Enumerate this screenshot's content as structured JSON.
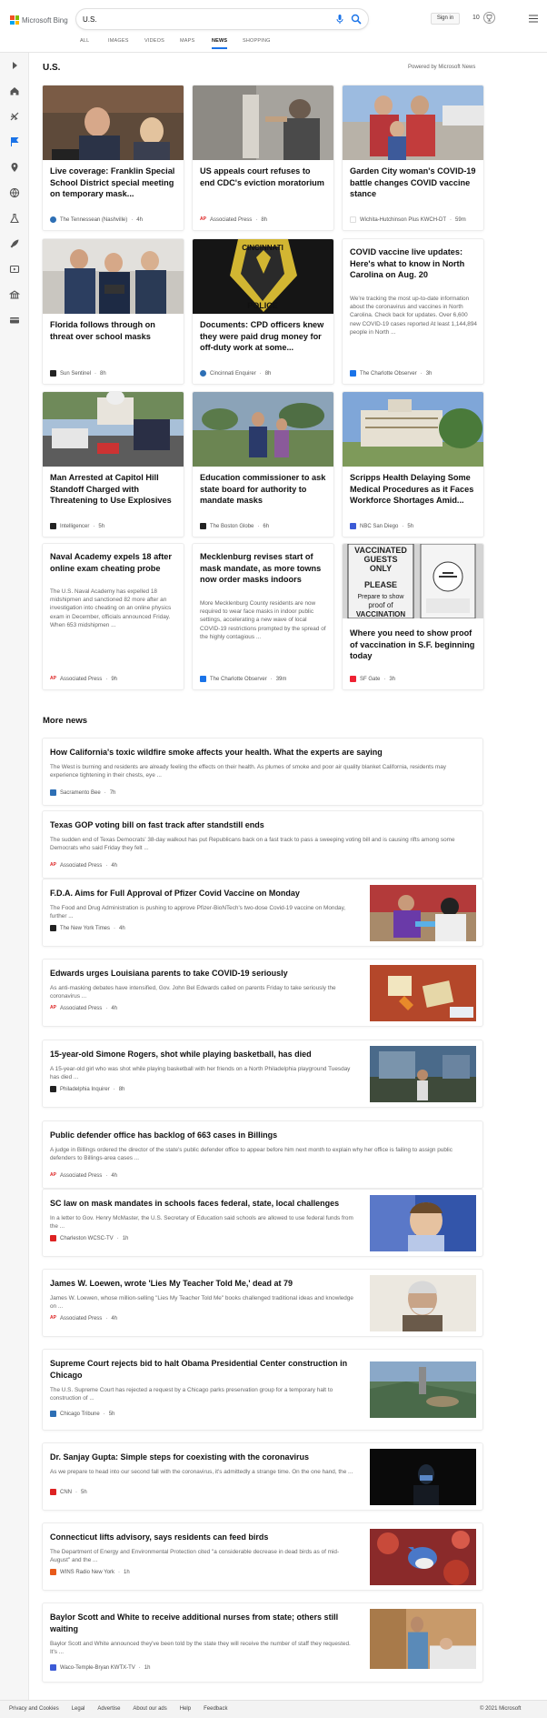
{
  "header": {
    "logo_text": "Microsoft Bing",
    "search_value": "U.S.",
    "signin_label": "Sign in",
    "points": "10"
  },
  "tabs": [
    {
      "label": "ALL"
    },
    {
      "label": "IMAGES"
    },
    {
      "label": "VIDEOS"
    },
    {
      "label": "MAPS"
    },
    {
      "label": "NEWS",
      "active": true
    },
    {
      "label": "SHOPPING"
    }
  ],
  "rail_icons": [
    "expand-icon",
    "home-icon",
    "sports-icon",
    "flag-icon",
    "location-icon",
    "world-icon",
    "science-icon",
    "rocket-icon",
    "entertainment-icon",
    "business-icon",
    "money-icon"
  ],
  "section": {
    "title": "U.S.",
    "powered": "Powered by Microsoft News"
  },
  "cards": [
    {
      "title": "Live coverage: Franklin Special School District special meeting on temporary mask...",
      "source": "The Tennessean (Nashville)",
      "time": "4h",
      "fav_color": "#2d6fb5",
      "img_colors": [
        "#6b4f3a",
        "#a88b6a"
      ]
    },
    {
      "title": "US appeals court refuses to end CDC's eviction moratorium",
      "source": "Associated Press",
      "time": "8h",
      "fav_color": "#d22",
      "img_colors": [
        "#9c9a94",
        "#5a5855"
      ]
    },
    {
      "title": "Garden City woman's COVID-19 battle changes COVID vaccine stance",
      "source": "Wichita-Hutchinson Plus KWCH-DT",
      "time": "59m",
      "fav_color": "#fff",
      "img_colors": [
        "#8ab0d8",
        "#b8554a"
      ]
    },
    {
      "title": "COVID vaccine live updates: Here's what to know in North Carolina on Aug. 20",
      "desc": "We're tracking the most up-to-date information about the coronavirus and vaccines in North Carolina. Check back for updates. Over 6,600 new COVID-19 cases reported At least 1,144,894 people in North ...",
      "source": "The Charlotte Observer",
      "time": "3h",
      "fav_color": "#1a73e8"
    },
    {
      "title": "Florida follows through on threat over school masks",
      "source": "Sun Sentinel",
      "time": "8h",
      "fav_color": "#222",
      "img_colors": [
        "#3b5c8a",
        "#c9c6c0"
      ]
    },
    {
      "title": "Documents: CPD officers knew they were paid drug money for off-duty work at some...",
      "source": "Cincinnati Enquirer",
      "time": "8h",
      "fav_color": "#2d6fb5",
      "img_colors": [
        "#1a1a1a",
        "#d2b632"
      ]
    },
    {
      "title": "Scripps Health Delaying Some Medical Procedures as it Faces Workforce Shortages Amid...",
      "source": "NBC San Diego",
      "time": "5h",
      "fav_color": "#3c5bd6",
      "img_colors": [
        "#7fa6d8",
        "#9a8b6a"
      ]
    },
    {
      "title": "Man Arrested at Capitol Hill Standoff Charged with Threatening to Use Explosives",
      "source": "Intelligencer",
      "time": "5h",
      "fav_color": "#222",
      "img_colors": [
        "#6f8a5a",
        "#3a3e52"
      ]
    },
    {
      "title": "Education commissioner to ask state board for authority to mandate masks",
      "source": "The Boston Globe",
      "time": "6h",
      "fav_color": "#222",
      "img_colors": [
        "#8ba3b8",
        "#6b8552"
      ]
    },
    {
      "title": "Naval Academy expels 18 after online exam cheating probe",
      "desc": "The U.S. Naval Academy has expelled 18 midshipmen and sanctioned 82 more after an investigation into cheating on an online physics exam in December, officials announced Friday. When 653 midshipmen ...",
      "source": "Associated Press",
      "time": "9h",
      "fav_color": "#d22"
    },
    {
      "title": "Mecklenburg revises start of mask mandate, as more towns now order masks indoors",
      "desc": "More Mecklenburg County residents are now required to wear face masks in indoor public settings, accelerating a new wave of local COVID-19 restrictions prompted by the spread of the highly contagious ...",
      "source": "The Charlotte Observer",
      "time": "39m",
      "fav_color": "#1a73e8"
    },
    {
      "title": "Where you need to show proof of vaccination in S.F. beginning today",
      "source": "SF Gate",
      "time": "3h",
      "fav_color": "#e23",
      "img_colors": [
        "#d9d9d9",
        "#333"
      ],
      "sign_text": [
        "VACCINATED",
        "GUESTS",
        "ONLY",
        "PLEASE",
        "Prepare to show",
        "proof of",
        "VACCINATION"
      ]
    }
  ],
  "more": {
    "title": "More news"
  },
  "news": [
    {
      "title": "How California's toxic wildfire smoke affects your health. What the experts are saying",
      "desc": "The West is burning and residents are already feeling the effects on their health. As plumes of smoke and poor air quality blanket California, residents may experience tightening in their chests, eye ...",
      "source": "Sacramento Bee",
      "time": "7h",
      "fav_color": "#2d6fb5"
    },
    {
      "title": "Texas GOP voting bill on fast track after standstill ends",
      "desc": "The sudden end of Texas Democrats' 38-day walkout has put Republicans back on a fast track to pass a sweeping voting bill and is causing rifts among some Democrats who said Friday they felt ...",
      "source": "Associated Press",
      "time": "4h",
      "fav_color": "#d22"
    },
    {
      "title": "F.D.A. Aims for Full Approval of Pfizer Covid Vaccine on Monday",
      "desc": "The Food and Drug Administration is pushing to approve Pfizer-BioNTech's two-dose Covid-19 vaccine on Monday, further ...",
      "source": "The New York Times",
      "time": "4h",
      "fav_color": "#222",
      "img_colors": [
        "#b33a3a",
        "#d8d2c8"
      ]
    },
    {
      "title": "Edwards urges Louisiana parents to take COVID-19 seriously",
      "desc": "As anti-masking debates have intensified, Gov. John Bel Edwards called on parents Friday to take seriously the coronavirus ...",
      "source": "Associated Press",
      "time": "4h",
      "fav_color": "#d22",
      "img_colors": [
        "#b4472a",
        "#e6d7a8"
      ]
    },
    {
      "title": "15-year-old Simone Rogers, shot while playing basketball, has died",
      "desc": "A 15-year-old girl who was shot while playing basketball with her friends on a North Philadelphia playground Tuesday has died ...",
      "source": "Philadelphia Inquirer",
      "time": "8h",
      "fav_color": "#222",
      "img_colors": [
        "#4a6a8a",
        "#3e4a3a"
      ]
    },
    {
      "title": "Public defender office has backlog of 663 cases in Billings",
      "desc": "A judge in Billings ordered the director of the state's public defender office to appear before him next month to explain why her office is failing to assign public defenders to Billings-area cases ...",
      "source": "Associated Press",
      "time": "4h",
      "fav_color": "#d22"
    },
    {
      "title": "SC law on mask mandates in schools faces federal, state, local challenges",
      "desc": "In a letter to Gov. Henry McMaster, the U.S. Secretary of Education said schools are allowed to use federal funds from the ...",
      "source": "Charleston WCSC-TV",
      "time": "1h",
      "fav_color": "#d22",
      "img_colors": [
        "#3355aa",
        "#b8c8e8"
      ]
    },
    {
      "title": "James W. Loewen, wrote 'Lies My Teacher Told Me,' dead at 79",
      "desc": "James W. Loewen, whose million-selling \"Lies My Teacher Told Me\" books challenged traditional ideas and knowledge on ...",
      "source": "Associated Press",
      "time": "4h",
      "fav_color": "#d22",
      "img_colors": [
        "#e8e2d8",
        "#8a7a66"
      ]
    },
    {
      "title": "Supreme Court rejects bid to halt Obama Presidential Center construction in Chicago",
      "desc": "The U.S. Supreme Court has rejected a request by a Chicago parks preservation group for a temporary halt to construction of ...",
      "source": "Chicago Tribune",
      "time": "5h",
      "fav_color": "#2d6fb5",
      "img_colors": [
        "#5a7a5a",
        "#8aa8c8"
      ]
    },
    {
      "title": "Dr. Sanjay Gupta: Simple steps for coexisting with the coronavirus",
      "desc": "As we prepare to head into our second fall with the coronavirus, it's admittedly a strange time. On the one hand, the ...",
      "source": "CNN",
      "time": "5h",
      "fav_color": "#d22",
      "img_colors": [
        "#0a0a0a",
        "#1e2a3a"
      ]
    },
    {
      "title": "Connecticut lifts advisory, says residents can feed birds",
      "desc": "The Department of Energy and Environmental Protection cited \"a considerable decrease in dead birds as of mid-August\" and the ...",
      "source": "WINS Radio New York",
      "time": "1h",
      "fav_color": "#e85a1a",
      "img_colors": [
        "#8a2a2a",
        "#c84a3a"
      ]
    },
    {
      "title": "Baylor Scott and White to receive additional nurses from state; others still waiting",
      "desc": "Baylor Scott and White announced they've been told by the state they will receive the number of staff they requested. It's ...",
      "source": "Waco-Temple-Bryan KWTX-TV",
      "time": "1h",
      "fav_color": "#3c5bd6",
      "img_colors": [
        "#c89a6a",
        "#5a8ab8"
      ]
    }
  ],
  "footer": {
    "links": [
      "Privacy and Cookies",
      "Legal",
      "Advertise",
      "About our ads",
      "Help",
      "Feedback"
    ],
    "copyright": "© 2021 Microsoft"
  }
}
